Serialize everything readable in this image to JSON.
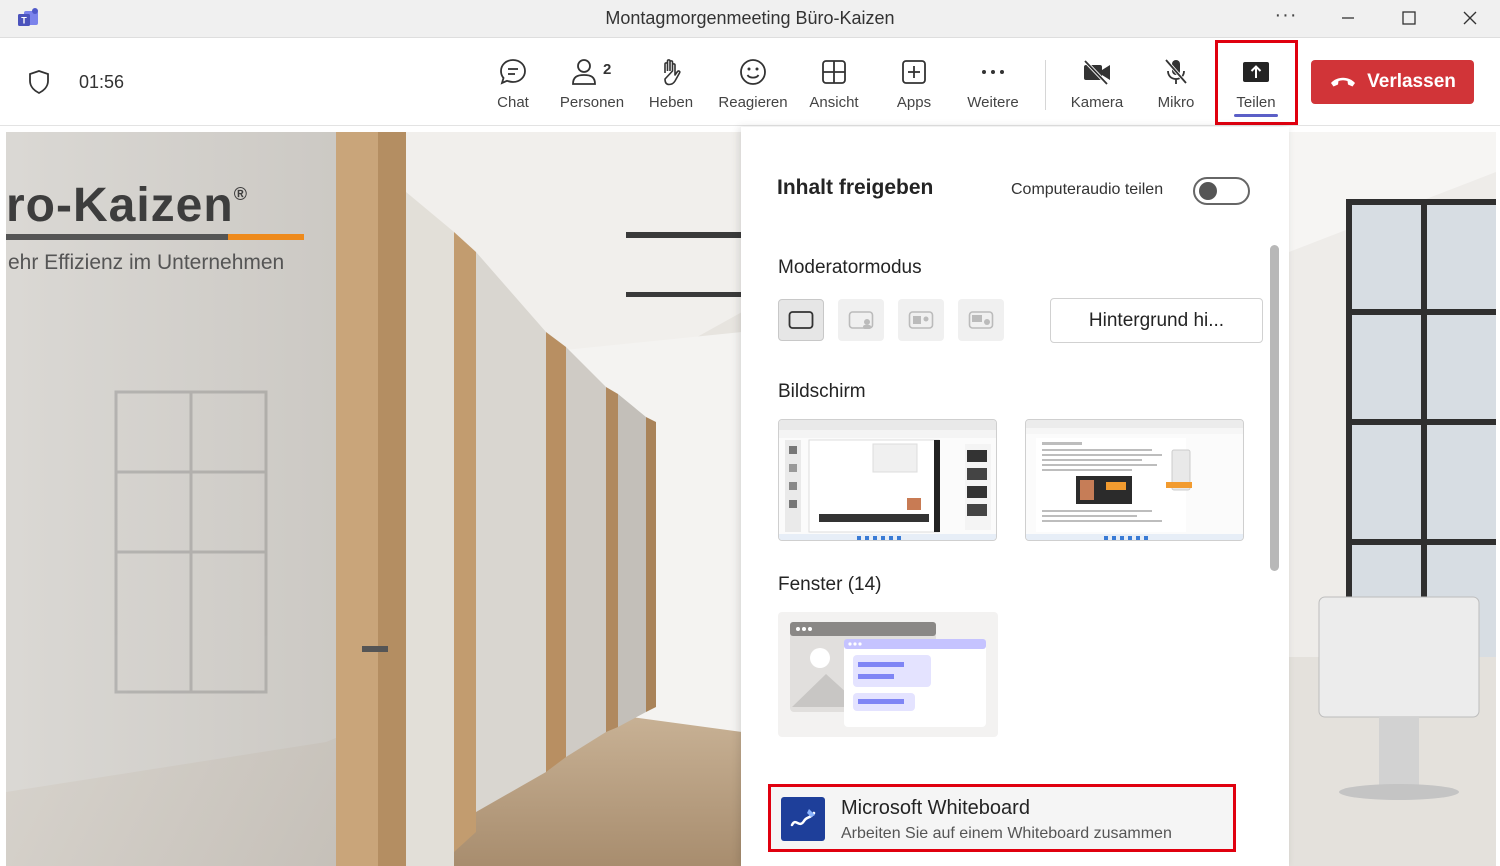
{
  "window": {
    "title": "Montagmorgenmeeting Büro-Kaizen",
    "more_label": "···"
  },
  "toolbar": {
    "timer": "01:56",
    "people_count": "2",
    "buttons": {
      "chat": "Chat",
      "people": "Personen",
      "raise": "Heben",
      "react": "Reagieren",
      "view": "Ansicht",
      "apps": "Apps",
      "more": "Weitere",
      "camera": "Kamera",
      "mic": "Mikro",
      "share": "Teilen"
    },
    "leave": "Verlassen"
  },
  "background": {
    "brand": "ro-Kaizen",
    "brand_reg": "®",
    "tagline": "ehr Effizienz im Unternehmen"
  },
  "share_panel": {
    "title": "Inhalt freigeben",
    "audio_label": "Computeraudio teilen",
    "presenter_mode_label": "Moderatormodus",
    "background_button": "Hintergrund hi...",
    "screen_label": "Bildschirm",
    "windows_label": "Fenster (14)",
    "whiteboard": {
      "title": "Microsoft Whiteboard",
      "subtitle": "Arbeiten Sie auf einem Whiteboard zusammen"
    }
  },
  "colors": {
    "leave_red": "#d13438",
    "highlight_red": "#e0000f",
    "accent_purple": "#5b5fc7",
    "whiteboard_blue": "#1e3f9a"
  }
}
